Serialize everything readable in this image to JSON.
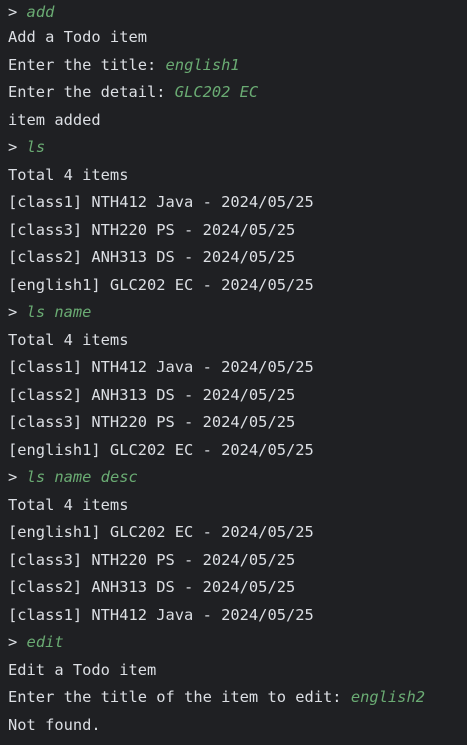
{
  "colors": {
    "background": "#1f2023",
    "output_text": "#dcdfe4",
    "user_input": "#6aab73"
  },
  "lines": [
    {
      "type": "command",
      "prompt": "> ",
      "input": "add"
    },
    {
      "type": "output",
      "text": "Add a Todo item"
    },
    {
      "type": "prompt_input",
      "text": "Enter the title: ",
      "input": "english1"
    },
    {
      "type": "prompt_input",
      "text": "Enter the detail: ",
      "input": "GLC202 EC"
    },
    {
      "type": "output",
      "text": "item added"
    },
    {
      "type": "command",
      "prompt": "> ",
      "input": "ls"
    },
    {
      "type": "output",
      "text": "Total 4 items"
    },
    {
      "type": "output",
      "text": "[class1] NTH412 Java - 2024/05/25"
    },
    {
      "type": "output",
      "text": "[class3] NTH220 PS - 2024/05/25"
    },
    {
      "type": "output",
      "text": "[class2] ANH313 DS - 2024/05/25"
    },
    {
      "type": "output",
      "text": "[english1] GLC202 EC - 2024/05/25"
    },
    {
      "type": "command",
      "prompt": "> ",
      "input": "ls name"
    },
    {
      "type": "output",
      "text": "Total 4 items"
    },
    {
      "type": "output",
      "text": "[class1] NTH412 Java - 2024/05/25"
    },
    {
      "type": "output",
      "text": "[class2] ANH313 DS - 2024/05/25"
    },
    {
      "type": "output",
      "text": "[class3] NTH220 PS - 2024/05/25"
    },
    {
      "type": "output",
      "text": "[english1] GLC202 EC - 2024/05/25"
    },
    {
      "type": "command",
      "prompt": "> ",
      "input": "ls name desc"
    },
    {
      "type": "output",
      "text": "Total 4 items"
    },
    {
      "type": "output",
      "text": "[english1] GLC202 EC - 2024/05/25"
    },
    {
      "type": "output",
      "text": "[class3] NTH220 PS - 2024/05/25"
    },
    {
      "type": "output",
      "text": "[class2] ANH313 DS - 2024/05/25"
    },
    {
      "type": "output",
      "text": "[class1] NTH412 Java - 2024/05/25"
    },
    {
      "type": "command",
      "prompt": "> ",
      "input": "edit"
    },
    {
      "type": "output",
      "text": "Edit a Todo item"
    },
    {
      "type": "prompt_input",
      "text": "Enter the title of the item to edit: ",
      "input": "english2"
    },
    {
      "type": "output",
      "text": "Not found."
    }
  ]
}
